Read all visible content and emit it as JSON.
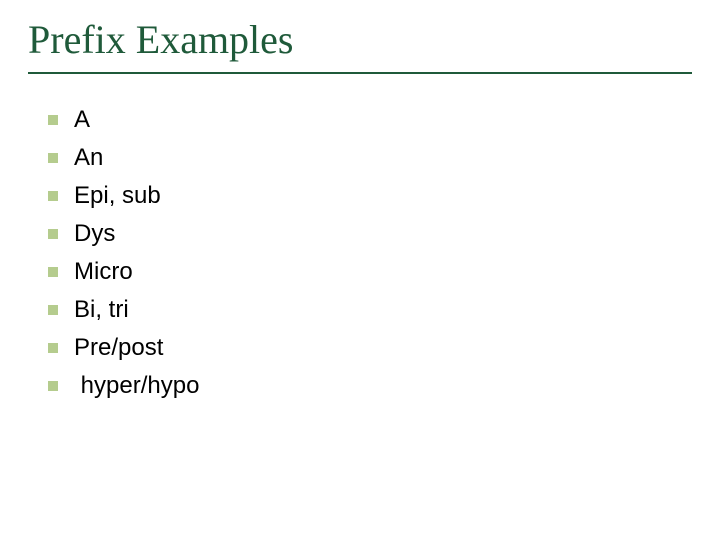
{
  "title": "Prefix Examples",
  "items": [
    "A",
    "An",
    "Epi, sub",
    "Dys",
    "Micro",
    "Bi, tri",
    "Pre/post",
    " hyper/hypo"
  ]
}
